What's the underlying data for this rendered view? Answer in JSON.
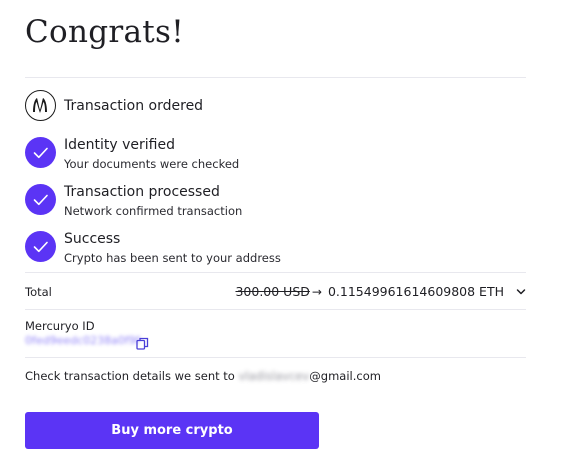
{
  "title": "Congrats!",
  "colors": {
    "accent": "#5b34f5",
    "divider": "#e8e8ee",
    "text": "#1f1f24"
  },
  "steps": [
    {
      "icon": "mercuryo-logo-icon",
      "label": "Transaction ordered",
      "sub": ""
    },
    {
      "icon": "check-icon",
      "label": "Identity verified",
      "sub": "Your documents were checked"
    },
    {
      "icon": "check-icon",
      "label": "Transaction processed",
      "sub": "Network confirmed transaction"
    },
    {
      "icon": "check-icon",
      "label": "Success",
      "sub": "Crypto has been sent to your address"
    }
  ],
  "total": {
    "label": "Total",
    "old_amount": "300.00 USD",
    "arrow": "→",
    "amount": "0.11549961614609808 ETH",
    "toggle_icon": "chevron-down-icon"
  },
  "mercuryo_id": {
    "label": "Mercuryo ID",
    "value": "0fed9eedc0238a0f9f",
    "copy_icon": "copy-icon"
  },
  "email_note": {
    "prefix": "Check transaction details we sent to ",
    "masked_user": "vladislavcev",
    "domain": "@gmail.com"
  },
  "buy_button": {
    "label": "Buy more crypto"
  }
}
